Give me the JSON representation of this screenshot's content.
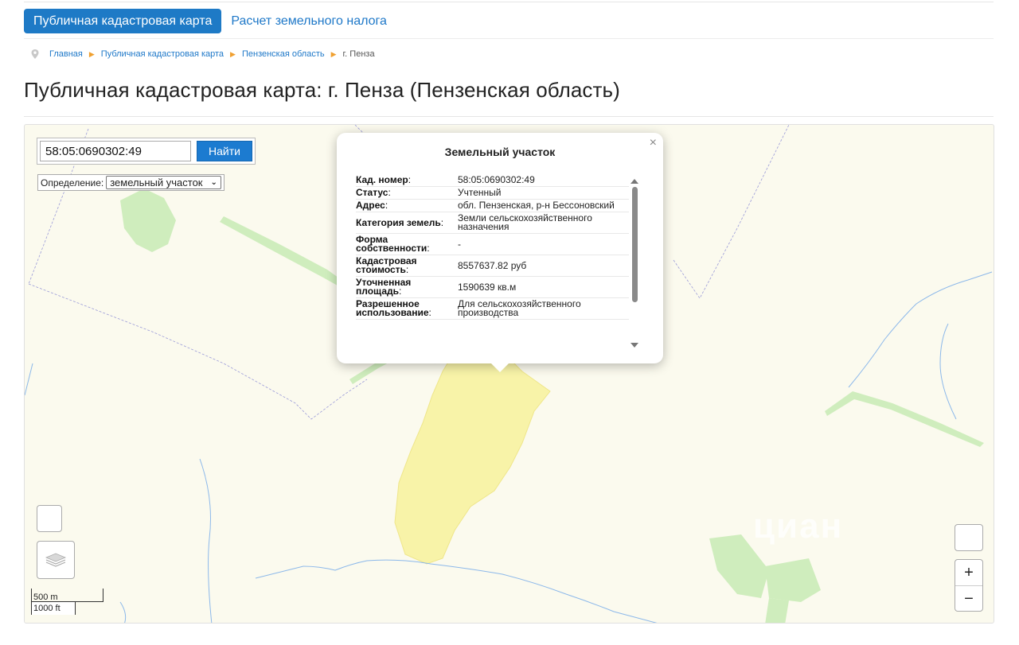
{
  "tabs": [
    {
      "label": "Публичная кадастровая карта",
      "active": true
    },
    {
      "label": "Расчет земельного налога",
      "active": false
    }
  ],
  "breadcrumb": {
    "items": [
      "Главная",
      "Публичная кадастровая карта",
      "Пензенская область"
    ],
    "current": "г. Пенза"
  },
  "page_title": "Публичная кадастровая карта: г. Пенза (Пензенская область)",
  "search": {
    "value": "58:05:0690302:49",
    "button": "Найти"
  },
  "definition": {
    "label": "Определение:",
    "selected": "земельный участок"
  },
  "popup": {
    "title": "Земельный участок",
    "close": "×",
    "rows": [
      {
        "key": "Кад. номер",
        "value": "58:05:0690302:49"
      },
      {
        "key": "Статус",
        "value": "Учтенный"
      },
      {
        "key": "Адрес",
        "value": "обл. Пензенская, р-н Бессоновский"
      },
      {
        "key": "Категория земель",
        "value": "Земли сельскохозяйственного назначения"
      },
      {
        "key": "Форма собственности",
        "value": "-"
      },
      {
        "key": "Кадастровая стоимость",
        "value": "8557637.82 руб"
      },
      {
        "key": "Уточненная площадь",
        "value": "1590639 кв.м"
      },
      {
        "key": "Разрешенное использование",
        "value": "Для сельскохозяйственного производства"
      }
    ]
  },
  "zoom": {
    "in": "+",
    "out": "−"
  },
  "scale": {
    "top": "500 m",
    "bottom": "1000 ft"
  },
  "watermark": "циан",
  "colors": {
    "accent": "#1e7ac6",
    "map_bg": "#fbfaee",
    "parcel": "#f8f3a8",
    "forest": "#cfedbd",
    "river": "#8cb8ea",
    "boundary": "#9a9ad8"
  },
  "icons": {
    "breadcrumb": "map-pin-icon",
    "layers": "layers-icon"
  }
}
